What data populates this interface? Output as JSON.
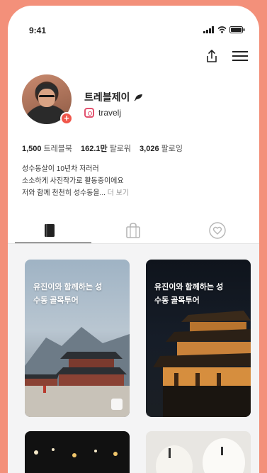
{
  "status_bar": {
    "time": "9:41"
  },
  "profile": {
    "name": "트레블제이",
    "handle": "travelj",
    "plus_badge": "+"
  },
  "stats": [
    {
      "value": "1,500",
      "label": "트레블북"
    },
    {
      "value": "162.1만",
      "label": "팔로워"
    },
    {
      "value": "3,026",
      "label": "팔로잉"
    }
  ],
  "bio": {
    "line1": "성수동살이 10년차 저러러",
    "line2": "소소하게 사진작가로 활동중이에요",
    "line3": "저와 함께 천천히 성수동을...",
    "more": "더 보기"
  },
  "tabs": [
    {
      "icon": "book-icon",
      "active": true
    },
    {
      "icon": "shopping-bag-icon",
      "active": false
    },
    {
      "icon": "heart-icon",
      "active": false
    }
  ],
  "cards": [
    {
      "title_line1": "유진이와 함께하는 성",
      "title_line2": "수동 골목투어"
    },
    {
      "title_line1": "유진이와 함께하는 성",
      "title_line2": "수동 골목투어"
    }
  ],
  "colors": {
    "background": "#f3907a",
    "accent": "#f0564a",
    "instagram": "#e2516e"
  }
}
